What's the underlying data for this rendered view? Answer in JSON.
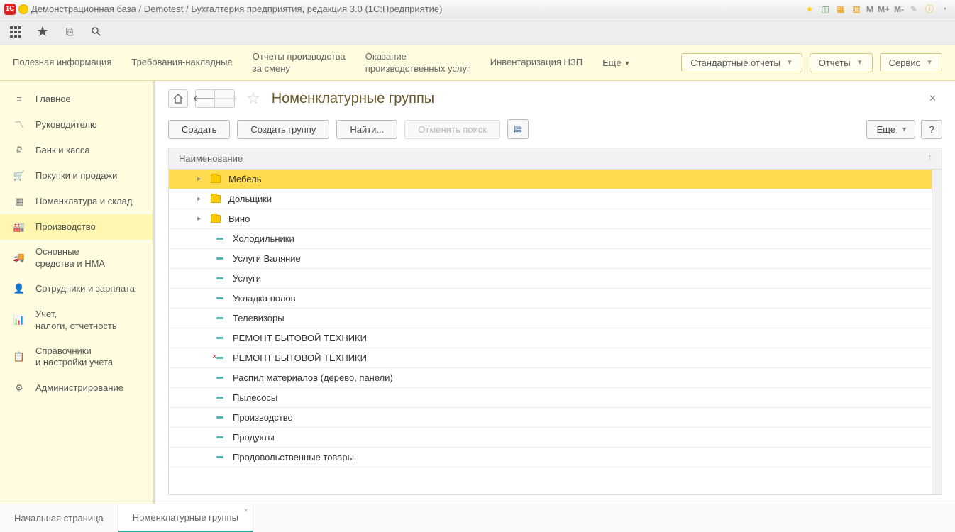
{
  "titlebar": {
    "text": "Демонстрационная база / Demotest / Бухгалтерия предприятия, редакция 3.0  (1С:Предприятие)",
    "mbuttons": [
      "M",
      "M+",
      "M-"
    ]
  },
  "toolbar2": {
    "links": [
      "Полезная информация",
      "Требования-накладные",
      "Отчеты производства\nза смену",
      "Оказание\nпроизводственных услуг",
      "Инвентаризация НЗП"
    ],
    "more": "Еще",
    "right": [
      {
        "label": "Стандартные отчеты"
      },
      {
        "label": "Отчеты"
      },
      {
        "label": "Сервис"
      }
    ]
  },
  "sidebar": [
    {
      "icon": "menu",
      "label": "Главное"
    },
    {
      "icon": "chart",
      "label": "Руководителю"
    },
    {
      "icon": "ruble",
      "label": "Банк и касса"
    },
    {
      "icon": "cart",
      "label": "Покупки и продажи"
    },
    {
      "icon": "boxes",
      "label": "Номенклатура и склад"
    },
    {
      "icon": "factory",
      "label": "Производство",
      "active": true
    },
    {
      "icon": "truck",
      "label": "Основные\nсредства и НМА"
    },
    {
      "icon": "person",
      "label": "Сотрудники и зарплата"
    },
    {
      "icon": "bars",
      "label": "Учет,\nналоги, отчетность"
    },
    {
      "icon": "book",
      "label": "Справочники\nи настройки учета"
    },
    {
      "icon": "gear",
      "label": "Администрирование"
    }
  ],
  "page": {
    "title": "Номенклатурные группы",
    "buttons": {
      "create": "Создать",
      "create_group": "Создать группу",
      "find": "Найти...",
      "cancel_find": "Отменить поиск",
      "more": "Еще",
      "help": "?"
    },
    "column": "Наименование"
  },
  "rows": [
    {
      "type": "folder",
      "expandable": true,
      "label": "Мебель",
      "selected": true
    },
    {
      "type": "folder",
      "expandable": true,
      "label": "Дольщики"
    },
    {
      "type": "folder",
      "expandable": true,
      "label": "Вино"
    },
    {
      "type": "item",
      "label": "Холодильники"
    },
    {
      "type": "item",
      "label": "Услуги Валяние"
    },
    {
      "type": "item",
      "label": "Услуги"
    },
    {
      "type": "item",
      "label": "Укладка полов"
    },
    {
      "type": "item",
      "label": "Телевизоры"
    },
    {
      "type": "item",
      "label": "РЕМОНТ БЫТОВОЙ ТЕХНИКИ"
    },
    {
      "type": "item",
      "deleted": true,
      "label": "РЕМОНТ БЫТОВОЙ ТЕХНИКИ"
    },
    {
      "type": "item",
      "label": "Распил материалов (дерево, панели)"
    },
    {
      "type": "item",
      "label": "Пылесосы"
    },
    {
      "type": "item",
      "label": "Производство"
    },
    {
      "type": "item",
      "label": "Продукты"
    },
    {
      "type": "item",
      "label": "Продовольственные товары"
    }
  ],
  "tabs": [
    {
      "label": "Начальная страница"
    },
    {
      "label": "Номенклатурные группы",
      "active": true,
      "closable": true
    }
  ]
}
